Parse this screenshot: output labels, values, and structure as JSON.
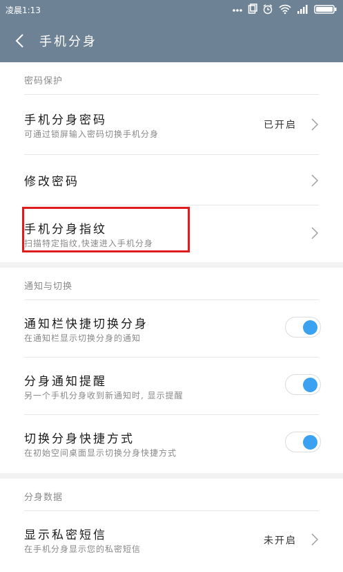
{
  "status_bar": {
    "time": "凌晨1:13",
    "icons": [
      "more-dots-icon",
      "sim-icon",
      "alarm-icon",
      "wifi-icon",
      "signal-icon",
      "battery-icon"
    ]
  },
  "title_bar": {
    "title": "手机分身"
  },
  "sections": {
    "password": {
      "header": "密码保护",
      "items": [
        {
          "title": "手机分身密码",
          "subtitle": "可通过锁屏输入密码切换手机分身",
          "value": "已开启"
        },
        {
          "title": "修改密码"
        },
        {
          "title": "手机分身指纹",
          "subtitle": "扫描特定指纹,快速进入手机分身"
        }
      ]
    },
    "notify": {
      "header": "通知与切换",
      "items": [
        {
          "title": "通知栏快捷切换分身",
          "subtitle": "在通知栏显示切换分身的通知",
          "toggle": "on"
        },
        {
          "title": "分身通知提醒",
          "subtitle": "另一个手机分身收到新通知时, 显示提醒",
          "toggle": "on"
        },
        {
          "title": "切换分身快捷方式",
          "subtitle": "在初始空间桌面显示切换分身快捷方式",
          "toggle": "on"
        }
      ]
    },
    "data": {
      "header": "分身数据",
      "items": [
        {
          "title": "显示私密短信",
          "subtitle": "在手机分身显示您的私密短信",
          "value": "未开启"
        }
      ]
    }
  },
  "colors": {
    "header_bg": "#6e8296",
    "toggle_on": "#3aa2f0",
    "highlight": "#e01b1b"
  }
}
